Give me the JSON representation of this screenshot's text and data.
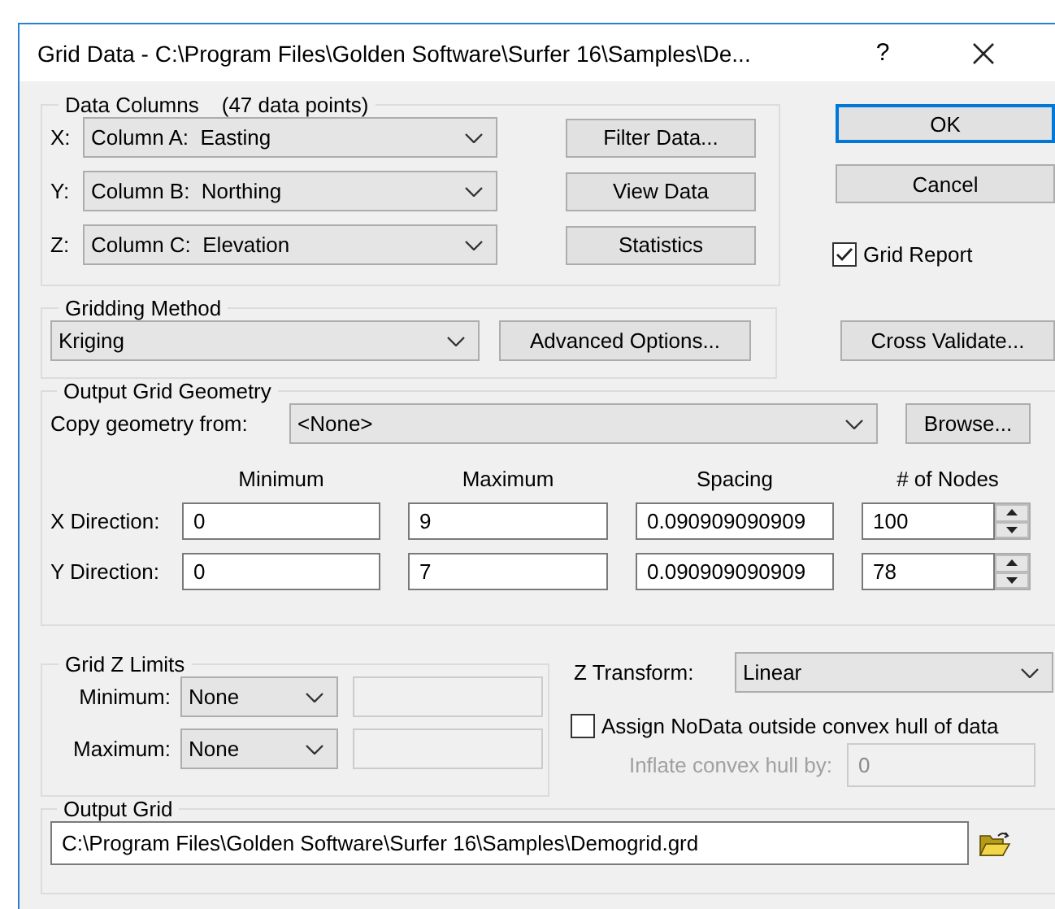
{
  "window": {
    "title": "Grid Data - C:\\Program Files\\Golden Software\\Surfer 16\\Samples\\De...",
    "help_button": "?"
  },
  "data_columns": {
    "title": "Data Columns",
    "count": "(47 data points)",
    "rows": [
      {
        "axis": "X:",
        "column": "Column A:  Easting",
        "button": "Filter Data..."
      },
      {
        "axis": "Y:",
        "column": "Column B:  Northing",
        "button": "View Data"
      },
      {
        "axis": "Z:",
        "column": "Column C:  Elevation",
        "button": "Statistics"
      }
    ]
  },
  "buttons": [
    {
      "label": "OK",
      "default": true
    },
    {
      "label": "Cancel",
      "default": false
    }
  ],
  "grid_report": {
    "label": "Grid Report",
    "checked": true
  },
  "gridding_method": {
    "title": "Gridding Method",
    "method": "Kriging",
    "button": "Advanced Options..."
  },
  "cross_validate": "Cross Validate...",
  "geometry": {
    "title": "Output Grid Geometry",
    "copy_label": "Copy geometry from:",
    "copy_value": "<None>",
    "browse": "Browse...",
    "columns": [
      "Minimum",
      "Maximum",
      "Spacing",
      "# of Nodes"
    ],
    "rows": [
      {
        "label": "X Direction:",
        "values": [
          "0",
          "9",
          "0.090909090909",
          "100"
        ]
      },
      {
        "label": "Y Direction:",
        "values": [
          "0",
          "7",
          "0.090909090909",
          "78"
        ]
      }
    ]
  },
  "z_limits": {
    "title": "Grid Z Limits",
    "rows": [
      {
        "label": "Minimum:",
        "mode": "None",
        "value_disabled": true
      },
      {
        "label": "Maximum:",
        "mode": "None",
        "value_disabled": true
      }
    ]
  },
  "z_transform": {
    "label": "Z Transform:",
    "value": "Linear"
  },
  "nodata": {
    "label": "Assign NoData outside convex hull of data",
    "checked": false
  },
  "inflate": {
    "label": "Inflate convex hull by:",
    "value": "0",
    "disabled": true
  },
  "output_grid": {
    "title": "Output Grid",
    "path": "C:\\Program Files\\Golden Software\\Surfer 16\\Samples\\Demogrid.grd"
  }
}
